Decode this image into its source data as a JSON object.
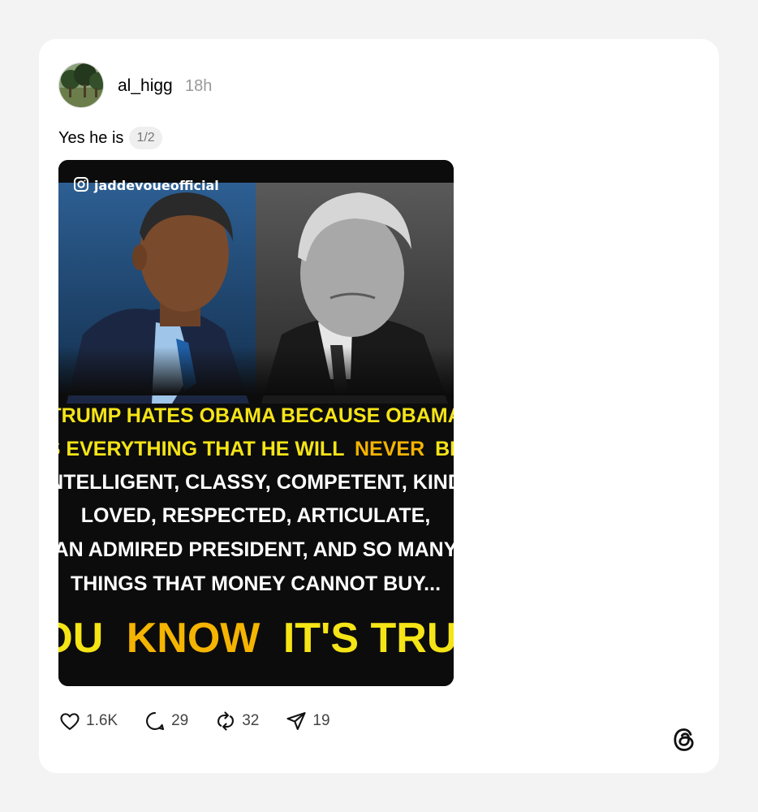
{
  "post": {
    "username": "al_higg",
    "time": "18h",
    "text": "Yes he is",
    "pager": "1/2"
  },
  "media": {
    "watermark": "jaddevoueofficial",
    "lines": [
      "TRUMP HATES OBAMA BECAUSE OBAMA",
      "IS EVERYTHING THAT HE WILL",
      "NEVER",
      "BE:",
      "INTELLIGENT, CLASSY, COMPETENT, KIND,",
      "LOVED, RESPECTED, ARTICULATE,",
      "AN ADMIRED PRESIDENT, AND SO MANY",
      "THINGS THAT MONEY CANNOT BUY...",
      "YOU",
      "KNOW",
      "IT'S TRUE!"
    ],
    "colors": {
      "yellow": "#f5e416",
      "gold": "#f4b400",
      "white": "#ffffff",
      "background": "#0c0c0c"
    }
  },
  "actions": {
    "likes": "1.6K",
    "comments": "29",
    "reposts": "32",
    "shares": "19"
  },
  "icons": {
    "like": "heart-icon",
    "comment": "comment-icon",
    "repost": "repost-icon",
    "share": "send-icon",
    "brand": "threads-logo-icon"
  }
}
